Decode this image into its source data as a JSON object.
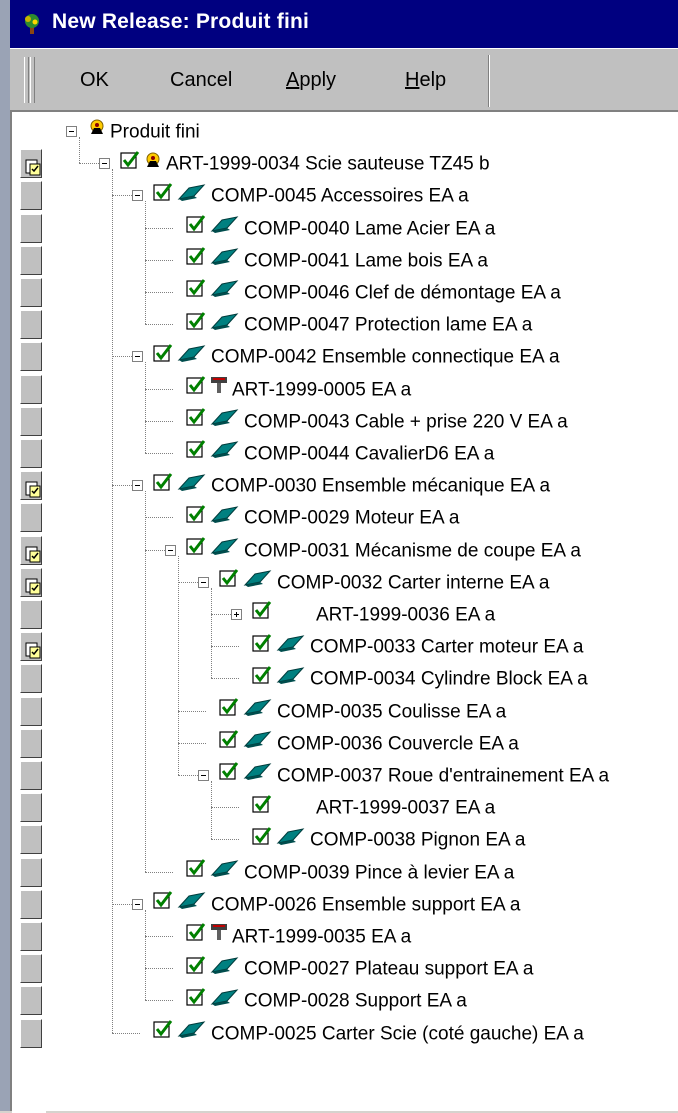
{
  "window": {
    "title": "New Release: Produit fini"
  },
  "toolbar": {
    "ok": "OK",
    "cancel": "Cancel",
    "apply": "Apply",
    "help": "Help"
  },
  "colors": {
    "title_bg": "#000080",
    "face": "#c0c0c0",
    "checkbox_green": "#008000",
    "part_teal": "#006b6b"
  },
  "tree": {
    "root": "Produit fini",
    "items": [
      "ART-1999-0034 Scie sauteuse TZ45  b",
      "COMP-0045 Accessoires EA a",
      "COMP-0040 Lame Acier EA a",
      "COMP-0041 Lame bois EA a",
      "COMP-0046 Clef de démontage EA a",
      "COMP-0047 Protection lame EA a",
      "COMP-0042 Ensemble connectique EA a",
      "ART-1999-0005  EA a",
      "COMP-0043 Cable + prise 220 V EA a",
      "COMP-0044 CavalierD6 EA a",
      "COMP-0030 Ensemble mécanique EA a",
      "COMP-0029 Moteur EA a",
      "COMP-0031 Mécanisme de coupe EA a",
      "COMP-0032 Carter interne EA a",
      "ART-1999-0036  EA a",
      "COMP-0033 Carter moteur EA a",
      "COMP-0034 Cylindre Block EA a",
      "COMP-0035 Coulisse EA a",
      "COMP-0036 Couvercle EA a",
      "COMP-0037 Roue d'entrainement EA a",
      "ART-1999-0037  EA a",
      "COMP-0038 Pignon EA a",
      "COMP-0039 Pince à levier EA a",
      "COMP-0026 Ensemble support EA a",
      "ART-1999-0035  EA a",
      "COMP-0027 Plateau support EA a",
      "COMP-0028 Support EA a",
      "COMP-0025 Carter Scie (coté gauche) EA a"
    ]
  }
}
